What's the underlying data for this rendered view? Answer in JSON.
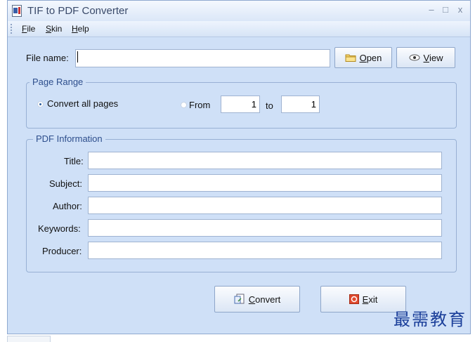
{
  "window": {
    "title": "TIF to PDF Converter",
    "controls": {
      "minimize": "–",
      "maximize": "□",
      "close": "x"
    }
  },
  "menu": {
    "items": [
      "File",
      "Skin",
      "Help"
    ]
  },
  "file": {
    "label": "File name:",
    "value": "",
    "open_label": "Open",
    "view_label": "View"
  },
  "page_range": {
    "title": "Page Range",
    "convert_all_label": "Convert all pages",
    "convert_all_selected": true,
    "from_label": "From",
    "from_value": "1",
    "to_label": "to",
    "to_value": "1"
  },
  "pdf_info": {
    "title": "PDF Information",
    "fields": [
      {
        "label": "Title:",
        "value": ""
      },
      {
        "label": "Subject:",
        "value": ""
      },
      {
        "label": "Author:",
        "value": ""
      },
      {
        "label": "Keywords:",
        "value": ""
      },
      {
        "label": "Producer:",
        "value": ""
      }
    ]
  },
  "actions": {
    "convert_label": "Convert",
    "exit_label": "Exit"
  },
  "watermark": "最需教育",
  "colors": {
    "window_bg": "#cfe0f7",
    "group_title": "#2d4e8c",
    "watermark": "#1b3f9a"
  }
}
